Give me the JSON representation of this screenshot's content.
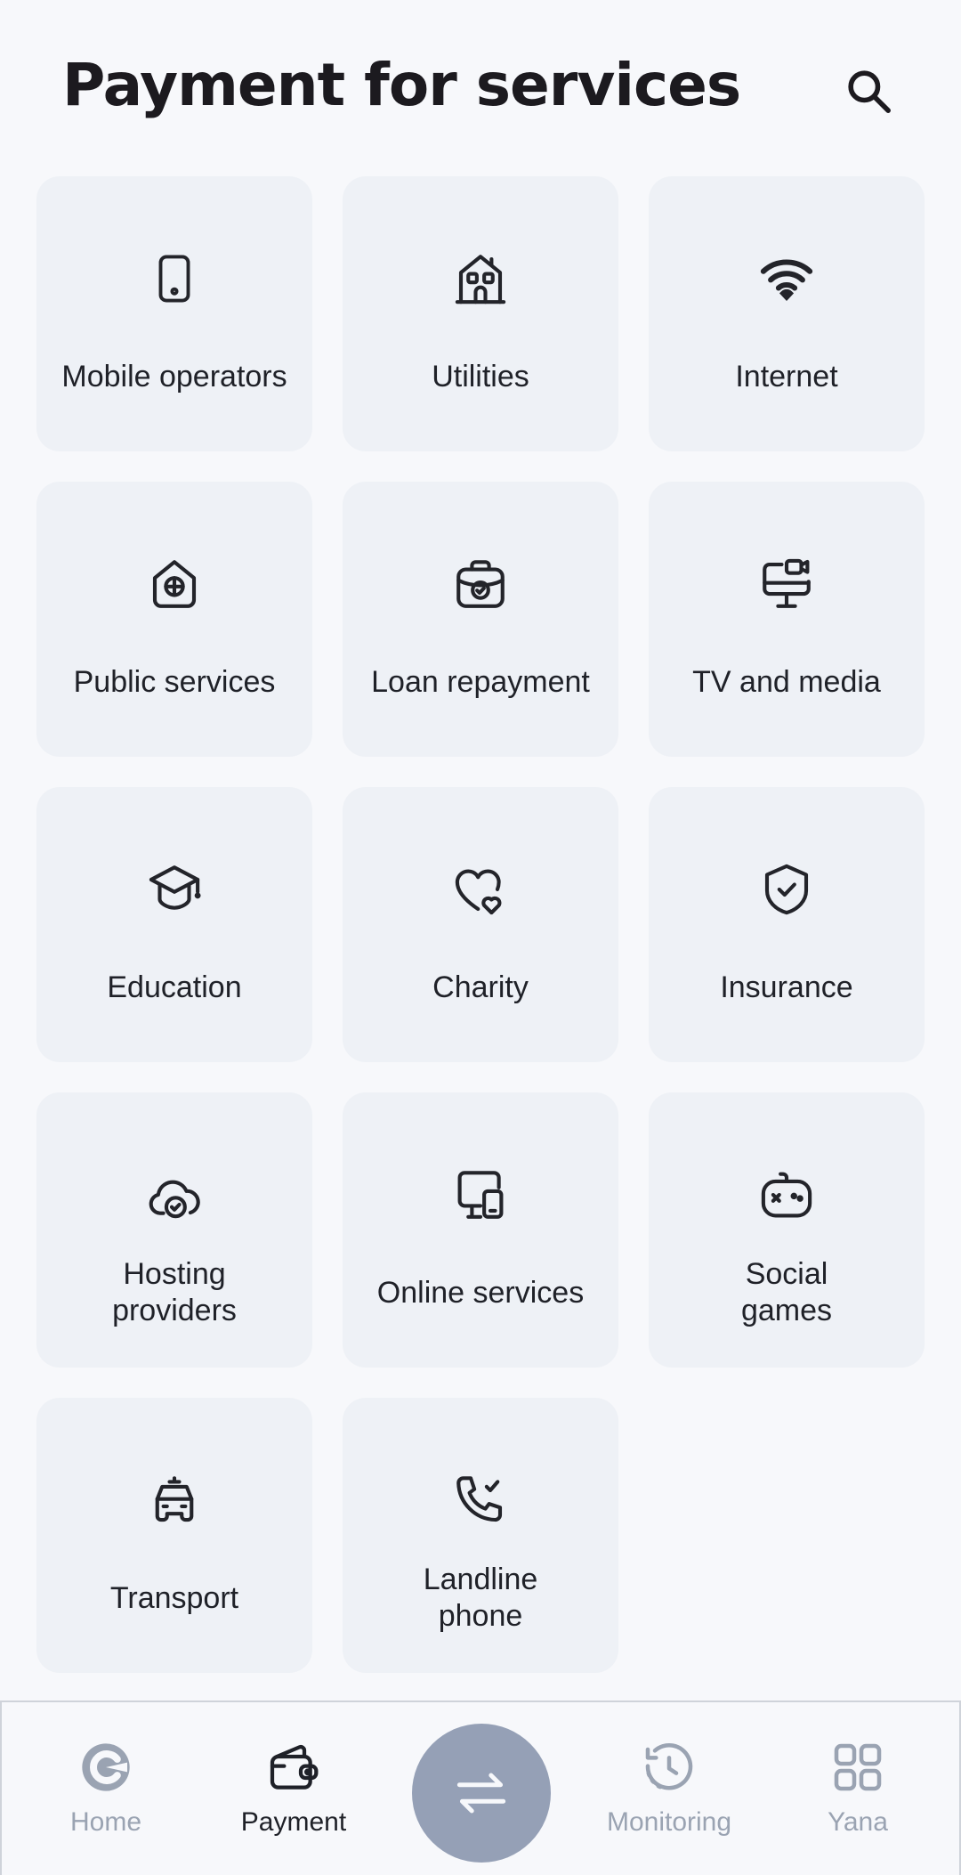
{
  "header": {
    "title": "Payment for services",
    "search_icon": "search-icon"
  },
  "services": [
    {
      "label": "Mobile operators",
      "icon": "smartphone-icon"
    },
    {
      "label": "Utilities",
      "icon": "house-icon"
    },
    {
      "label": "Internet",
      "icon": "wifi-icon"
    },
    {
      "label": "Public services",
      "icon": "public-building-icon"
    },
    {
      "label": "Loan repayment",
      "icon": "briefcase-check-icon"
    },
    {
      "label": "TV and media",
      "icon": "monitor-camera-icon"
    },
    {
      "label": "Education",
      "icon": "graduation-cap-icon"
    },
    {
      "label": "Charity",
      "icon": "hearts-icon"
    },
    {
      "label": "Insurance",
      "icon": "shield-check-icon"
    },
    {
      "label": "Hosting\nproviders",
      "icon": "cloud-check-icon"
    },
    {
      "label": "Online services",
      "icon": "devices-icon"
    },
    {
      "label": "Social\ngames",
      "icon": "gamepad-icon"
    },
    {
      "label": "Transport",
      "icon": "car-icon"
    },
    {
      "label": "Landline\nphone",
      "icon": "phone-check-icon"
    }
  ],
  "tabbar": {
    "home": "Home",
    "payment": "Payment",
    "transfer_icon": "transfer-arrows-icon",
    "monitoring": "Monitoring",
    "yana": "Yana"
  },
  "colors": {
    "background": "#f7f8fb",
    "tile": "#eef1f6",
    "icon_stroke": "#23242a",
    "inactive_tab": "#9aa3b2",
    "fab": "#95a0b6"
  }
}
